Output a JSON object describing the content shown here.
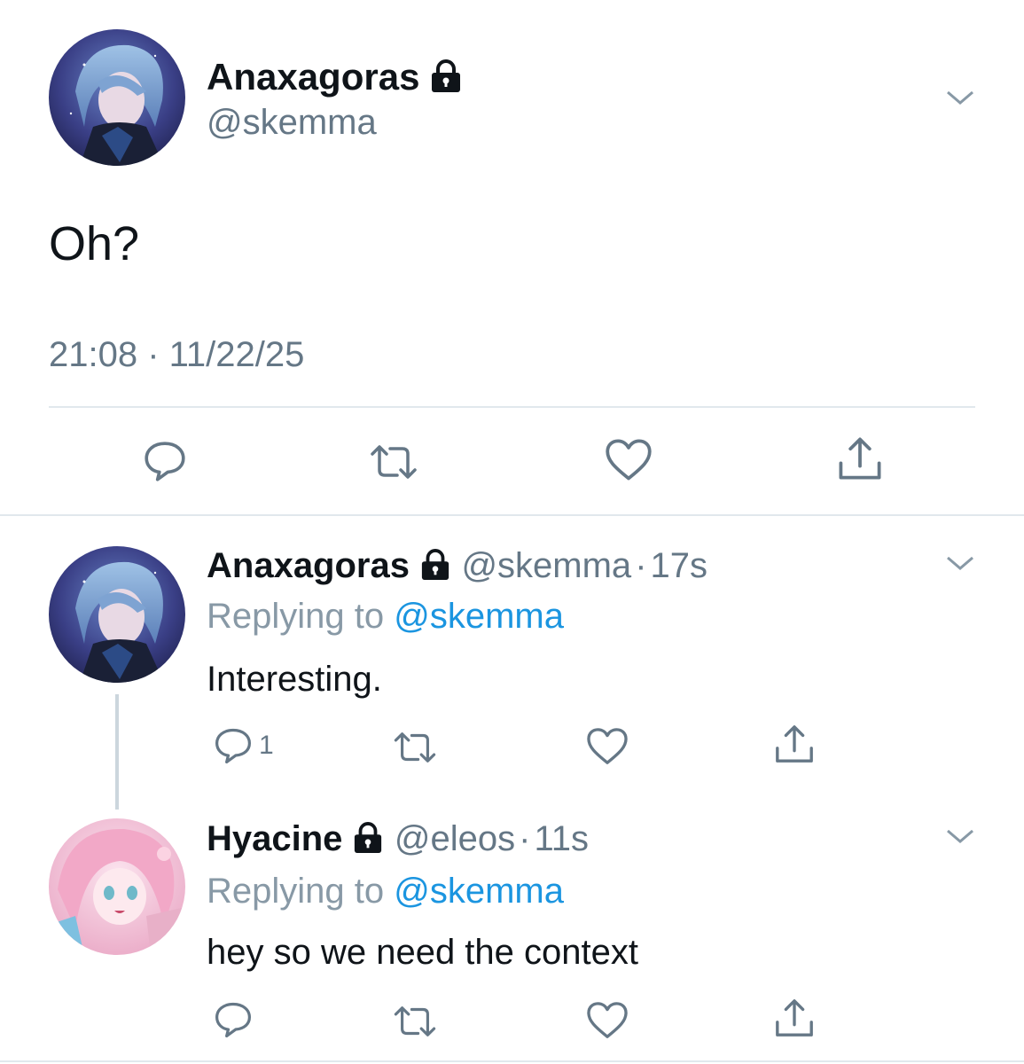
{
  "main_tweet": {
    "display_name": "Anaxagoras",
    "handle": "@skemma",
    "text": "Oh?",
    "timestamp": "21:08 · 11/22/25",
    "avatar_icon": "avatar-anaxagoras",
    "locked_icon": "lock-icon"
  },
  "replies": [
    {
      "display_name": "Anaxagoras",
      "handle": "@skemma",
      "separator": "·",
      "time": "17s",
      "replying_prefix": "Replying to",
      "replying_to": "@skemma",
      "text": "Interesting.",
      "reply_count": "1"
    },
    {
      "display_name": "Hyacine",
      "handle": "@eleos",
      "separator": "·",
      "time": "11s",
      "replying_prefix": "Replying to",
      "replying_to": "@skemma",
      "text": "hey so we need the context",
      "reply_count": ""
    }
  ],
  "colors": {
    "accent": "#1b95e0",
    "secondary_text": "#657786",
    "divider": "#e1e8ed"
  }
}
